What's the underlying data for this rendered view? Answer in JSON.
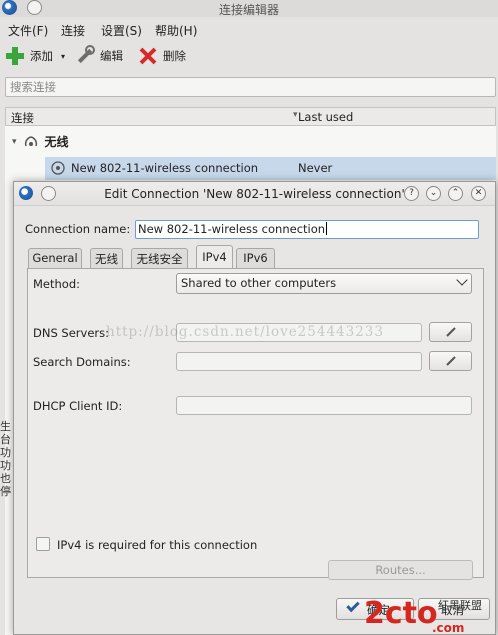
{
  "background_window": {
    "title": "连接编辑器",
    "menu": [
      {
        "label": "文件(F)",
        "mnemonic_index": 3
      },
      {
        "label": "连接"
      },
      {
        "label": "设置(S)",
        "mnemonic_index": 3
      },
      {
        "label": "帮助(H)",
        "mnemonic_index": 3
      }
    ],
    "toolbar": {
      "add": "添加",
      "edit": "编辑",
      "delete": "删除"
    },
    "search_placeholder": "搜索连接",
    "columns": {
      "connection": "连接",
      "last_used": "Last used"
    },
    "group_label": "无线",
    "rows": [
      {
        "name": "New 802-11-wireless connection",
        "last_used": "Never"
      }
    ],
    "left_edge_text": "生\n台\n功\n功\n也\n停"
  },
  "dialog": {
    "title": "Edit Connection 'New 802-11-wireless connection'",
    "connection_name_label": "Connection name:",
    "connection_name_value": "New 802-11-wireless connection",
    "tabs": [
      {
        "label": "General",
        "active": false
      },
      {
        "label": "无线",
        "active": false
      },
      {
        "label": "无线安全",
        "active": false
      },
      {
        "label": "IPv4",
        "active": true
      },
      {
        "label": "IPv6",
        "active": false
      }
    ],
    "method_label": "Method:",
    "method_value": "Shared to other computers",
    "dns_label": "DNS Servers:",
    "search_domains_label": "Search Domains:",
    "dhcp_label": "DHCP Client ID:",
    "ipv4_required_label": "IPv4 is required for this connection",
    "ipv4_required_checked": false,
    "routes_button": "Routes...",
    "ok_button": "确定",
    "cancel_button": "取消"
  },
  "watermark_text": "http://blog.csdn.net/love254443233",
  "logo": {
    "text": "2cto",
    "suffix": ".com",
    "subtitle": "红黑联盟"
  },
  "colors": {
    "accent_blue": "#2d6fbf",
    "selection": "#c7d8ea",
    "logo_red": "#d7261f"
  }
}
